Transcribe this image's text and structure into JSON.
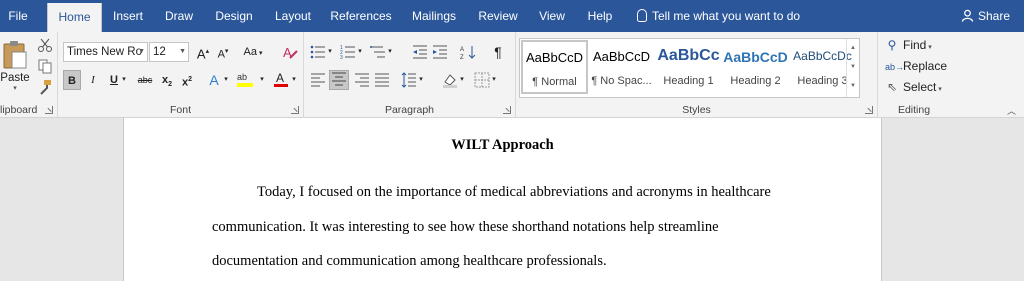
{
  "tabs": [
    "File",
    "Home",
    "Insert",
    "Draw",
    "Design",
    "Layout",
    "References",
    "Mailings",
    "Review",
    "View",
    "Help"
  ],
  "tell_me": "Tell me what you want to do",
  "share": "Share",
  "clipboard": {
    "paste": "Paste",
    "label": "lipboard"
  },
  "font": {
    "name": "Times New Ro",
    "size": "12",
    "label": "Font",
    "change_case": "Aa"
  },
  "paragraph": {
    "label": "Paragraph"
  },
  "styles": {
    "label": "Styles",
    "items": [
      {
        "sample": "AaBbCcD",
        "name": "¶ Normal"
      },
      {
        "sample": "AaBbCcD",
        "name": "¶ No Spac..."
      },
      {
        "sample": "AaBbCc",
        "name": "Heading 1"
      },
      {
        "sample": "AaBbCcD",
        "name": "Heading 2"
      },
      {
        "sample": "AaBbCcDc",
        "name": "Heading 3"
      }
    ]
  },
  "editing": {
    "label": "Editing",
    "find": "Find",
    "replace": "Replace",
    "select": "Select"
  },
  "document": {
    "title": "WILT Approach",
    "lines": [
      "Today, I focused on the importance of medical abbreviations and acronyms in healthcare",
      "communication. It was interesting to see how these shorthand notations help streamline",
      "documentation and communication among healthcare professionals."
    ]
  },
  "colors": {
    "accent": "#2b579a",
    "highlight": "#ffff00",
    "font_color": "#e00000"
  }
}
